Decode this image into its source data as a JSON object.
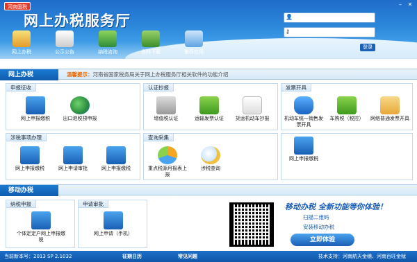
{
  "app": {
    "province_tag": "河南国税",
    "title": "网上办税服务厅"
  },
  "window": {
    "min": "–",
    "close": "✕"
  },
  "login": {
    "username_placeholder": "",
    "password_placeholder": "",
    "button": "登录"
  },
  "toolbar": [
    {
      "label": "网上办税",
      "icon": "tax-icon"
    },
    {
      "label": "公示公告",
      "icon": "pin-icon"
    },
    {
      "label": "纳税咨询",
      "icon": "people-icon"
    },
    {
      "label": "资料下载",
      "icon": "download-icon"
    },
    {
      "label": "推荐应用",
      "icon": "app-icon"
    }
  ],
  "nav": {
    "tab": "网上办税",
    "tip_label": "温馨提示：",
    "tip_text": "河南省国家税务局关于网上办税服务厅相关软件的功能介绍"
  },
  "panels": {
    "declare": {
      "title": "申报征收",
      "items": [
        "网上申报缴税",
        "出口退税预申报"
      ]
    },
    "cert": {
      "title": "认证抄报",
      "items": [
        "增值税认证",
        "运输发票认证",
        "货运机动车抄报"
      ]
    },
    "invoice": {
      "title": "发票开具",
      "items": [
        "机动车统一销售发票开具",
        "车购税（税控）",
        "网络普通发票开具"
      ]
    },
    "affairs": {
      "title": "涉税事项办理",
      "items": [
        "网上申报缴税",
        "网上申请审批",
        "网上申报缴税"
      ]
    },
    "query": {
      "title": "查询采集",
      "items": [
        "重点税源月报表上报",
        "涉税查询"
      ]
    },
    "extra": {
      "items": [
        "网上申报缴税"
      ]
    }
  },
  "mobile": {
    "tab": "移动办税",
    "tax_declare": {
      "title": "纳税申报",
      "items": [
        "个体定定户网上申报缴税"
      ]
    },
    "apply": {
      "title": "申请审批",
      "items": [
        "网上申请（手机）"
      ]
    },
    "promo": "移动办税 全新功能等你体验！",
    "step1": "扫描二维码",
    "step2": "安装移动办税",
    "try_button": "立即体验"
  },
  "footer": {
    "version": "当前新本号：2013 SP 2.1032",
    "calendar": "征期日历",
    "faq": "常见问题",
    "support": "技术支持：河南航天金穗、河南百旺金赋"
  }
}
